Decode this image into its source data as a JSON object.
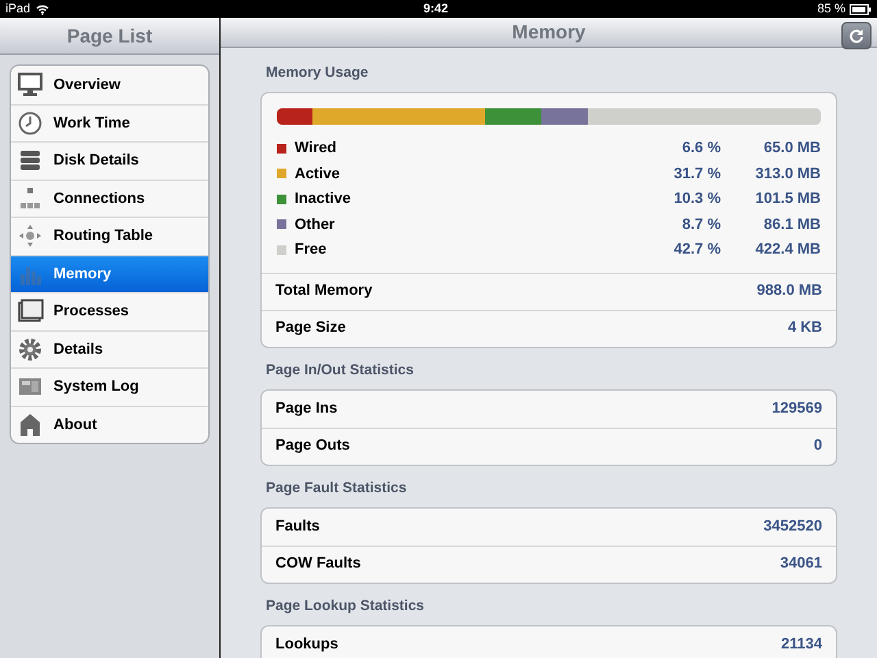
{
  "status_bar": {
    "device": "iPad",
    "time": "9:42",
    "battery": "85 %"
  },
  "sidebar": {
    "title": "Page List",
    "items": [
      {
        "label": "Overview",
        "selected": false
      },
      {
        "label": "Work Time",
        "selected": false
      },
      {
        "label": "Disk Details",
        "selected": false
      },
      {
        "label": "Connections",
        "selected": false
      },
      {
        "label": "Routing Table",
        "selected": false
      },
      {
        "label": "Memory",
        "selected": true
      },
      {
        "label": "Processes",
        "selected": false
      },
      {
        "label": "Details",
        "selected": false
      },
      {
        "label": "System Log",
        "selected": false
      },
      {
        "label": "About",
        "selected": false
      }
    ]
  },
  "main": {
    "title": "Memory",
    "memory_usage": {
      "header": "Memory Usage",
      "segments": [
        {
          "name": "Wired",
          "color": "#b8231c",
          "percent": "6.6 %",
          "size": "65.0 MB"
        },
        {
          "name": "Active",
          "color": "#e0a82a",
          "percent": "31.7 %",
          "size": "313.0 MB"
        },
        {
          "name": "Inactive",
          "color": "#3d9138",
          "percent": "10.3 %",
          "size": "101.5 MB"
        },
        {
          "name": "Other",
          "color": "#77739a",
          "percent": "8.7 %",
          "size": "86.1 MB"
        },
        {
          "name": "Free",
          "color": "#cfcfcb",
          "percent": "42.7 %",
          "size": "422.4 MB"
        }
      ],
      "rows": [
        {
          "label": "Total Memory",
          "value": "988.0 MB"
        },
        {
          "label": "Page Size",
          "value": "4 KB"
        }
      ]
    },
    "sections": [
      {
        "header": "Page In/Out Statistics",
        "rows": [
          {
            "label": "Page Ins",
            "value": "129569"
          },
          {
            "label": "Page Outs",
            "value": "0"
          }
        ]
      },
      {
        "header": "Page Fault Statistics",
        "rows": [
          {
            "label": "Faults",
            "value": "3452520"
          },
          {
            "label": "COW Faults",
            "value": "34061"
          }
        ]
      },
      {
        "header": "Page Lookup Statistics",
        "rows": [
          {
            "label": "Lookups",
            "value": "21134"
          }
        ]
      }
    ]
  }
}
